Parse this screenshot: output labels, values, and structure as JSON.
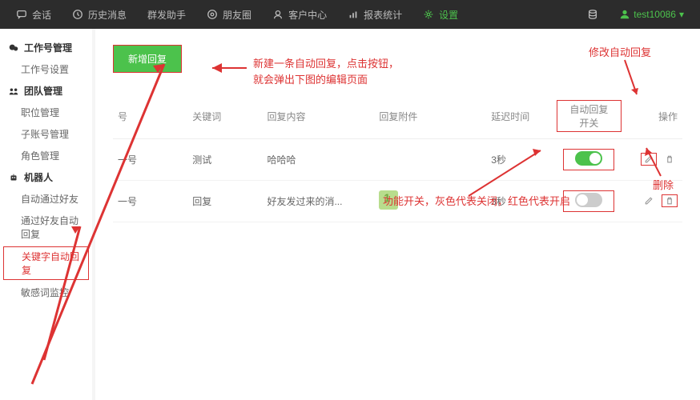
{
  "topbar": {
    "items": [
      {
        "label": "会话",
        "icon": "chat"
      },
      {
        "label": "历史消息",
        "icon": "history"
      },
      {
        "label": "群发助手",
        "icon": "broadcast"
      },
      {
        "label": "朋友圈",
        "icon": "moments"
      },
      {
        "label": "客户中心",
        "icon": "customer"
      },
      {
        "label": "报表统计",
        "icon": "stats"
      },
      {
        "label": "设置",
        "icon": "settings",
        "active": true
      }
    ],
    "database_icon": "data",
    "user": "test10086"
  },
  "sidebar": {
    "sections": [
      {
        "header": "工作号管理",
        "icon": "wechat",
        "items": [
          "工作号设置"
        ]
      },
      {
        "header": "团队管理",
        "icon": "team",
        "items": [
          "职位管理",
          "子账号管理",
          "角色管理"
        ]
      },
      {
        "header": "机器人",
        "icon": "robot",
        "items": [
          "自动通过好友",
          "通过好友自动回复",
          "关键字自动回复",
          "敏感词监控"
        ],
        "activeIndex": 2
      }
    ]
  },
  "content": {
    "add_button": "新增回复",
    "columns": [
      "号",
      "关键词",
      "回复内容",
      "回复附件",
      "延迟时间",
      "自动回复开关",
      "操作"
    ],
    "rows": [
      {
        "name": "一号",
        "keyword": "测试",
        "content": "哈哈哈",
        "attach": "",
        "delay": "3秒",
        "toggle": true
      },
      {
        "name": "一号",
        "keyword": "回复",
        "content": "好友发过来的消...",
        "attach": "img",
        "delay": "3秒",
        "toggle": false
      }
    ]
  },
  "annotations": {
    "create": "新建一条自动回复，点击按钮，\n就会弹出下图的编辑页面",
    "edit": "修改自动回复",
    "delete": "删除",
    "toggle": "功能开关，灰色代表关闭，红色代表开启"
  }
}
